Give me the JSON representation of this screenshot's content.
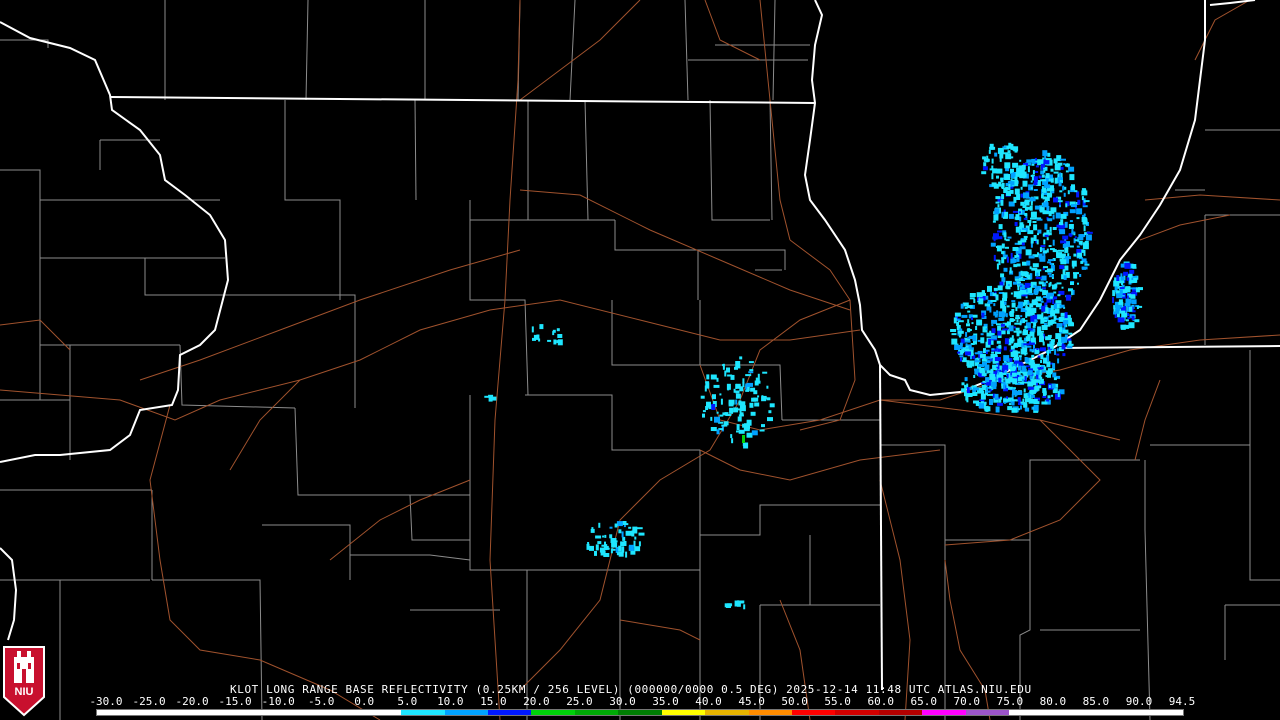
{
  "product": {
    "title": "KLOT LONG RANGE BASE REFLECTIVITY (0.25KM / 256 LEVEL) (000000/0000 0.5 DEG) 2025-12-14 11:48 UTC  ATLAS.NIU.EDU"
  },
  "logo": {
    "text": "NIU",
    "color": "#c8102e"
  },
  "colorbar": {
    "ticks": [
      "-30.0",
      "-25.0",
      "-20.0",
      "-15.0",
      "-10.0",
      "-5.0",
      "0.0",
      "5.0",
      "10.0",
      "15.0",
      "20.0",
      "25.0",
      "30.0",
      "35.0",
      "40.0",
      "45.0",
      "50.0",
      "55.0",
      "60.0",
      "65.0",
      "70.0",
      "75.0",
      "80.0",
      "85.0",
      "90.0",
      "94.5"
    ],
    "colors": [
      "#ffffff",
      "#ffffff",
      "#ffffff",
      "#ffffff",
      "#ffffff",
      "#ffffff",
      "#ffffff",
      "#1ee6ff",
      "#00a2ff",
      "#0018ff",
      "#00d20a",
      "#00aa06",
      "#007d03",
      "#ffff00",
      "#e6b400",
      "#ff8c00",
      "#ff0000",
      "#d20000",
      "#b40000",
      "#ff00ff",
      "#9b55c9",
      "#ffffff",
      "#ffffff",
      "#ffffff",
      "#ffffff"
    ]
  },
  "map_colors": {
    "state_border": "#ffffff",
    "county_border": "#8c8c8c",
    "highway": "#a0522d",
    "background": "#000000",
    "echo_light": "#1ee6ff",
    "echo_mid": "#00a2ff",
    "echo_heavy": "#0018ff",
    "echo_green": "#00d20a"
  }
}
